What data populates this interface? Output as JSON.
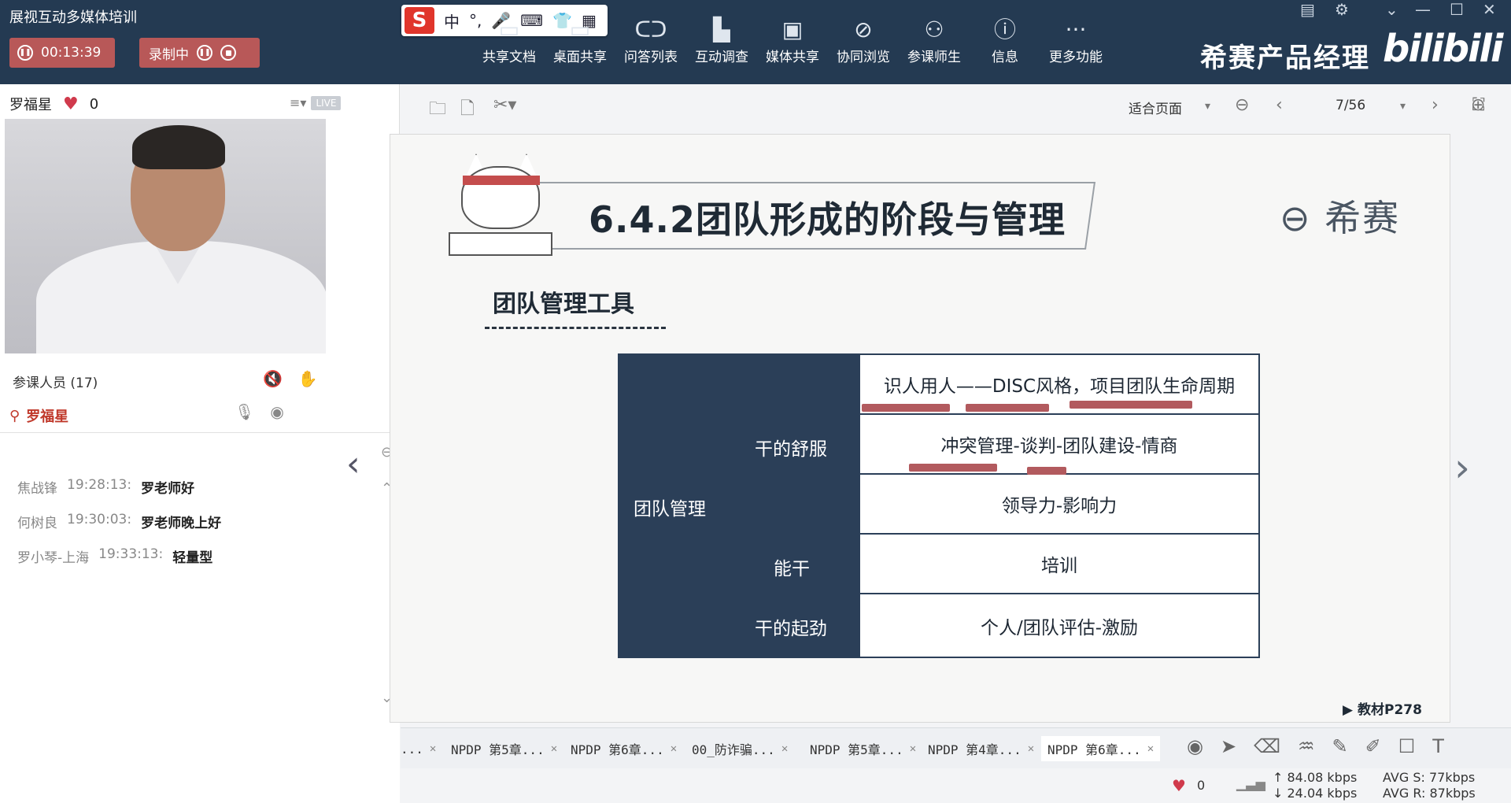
{
  "window": {
    "title": "展视互动多媒体培训"
  },
  "recording": {
    "timer": "00:13:39",
    "status_label": "录制中"
  },
  "ime": {
    "lang": "中",
    "punct": "°,"
  },
  "toolbar": [
    {
      "label": "共享文档",
      "icon": "document-icon"
    },
    {
      "label": "桌面共享",
      "icon": "desktop-icon"
    },
    {
      "label": "问答列表",
      "icon": "qa-icon"
    },
    {
      "label": "互动调查",
      "icon": "chart-icon"
    },
    {
      "label": "媒体共享",
      "icon": "media-icon"
    },
    {
      "label": "协同浏览",
      "icon": "compass-icon"
    },
    {
      "label": "参课师生",
      "icon": "users-icon"
    },
    {
      "label": "信息",
      "icon": "info-icon"
    },
    {
      "label": "更多功能",
      "icon": "more-icon"
    }
  ],
  "brand": {
    "name": "希赛产品经理",
    "site": "bilibili"
  },
  "presenter": {
    "name": "罗福星",
    "likes": "0",
    "live": "LIVE"
  },
  "attendees": {
    "label": "参课人员 (17)",
    "self_name": "罗福星"
  },
  "chat": [
    {
      "user": "焦战锋",
      "time": "19:28:13:",
      "text": "罗老师好"
    },
    {
      "user": "何树良",
      "time": "19:30:03:",
      "text": "罗老师晚上好"
    },
    {
      "user": "罗小琴-上海",
      "time": "19:33:13:",
      "text": "轻量型"
    }
  ],
  "doc_toolbar": {
    "zoom": "适合页面",
    "page": "7/56"
  },
  "slide": {
    "title": "6.4.2团队形成的阶段与管理",
    "logo": "希赛",
    "section": "团队管理工具",
    "table": {
      "group_label": "团队管理",
      "sub_labels": [
        "干的舒服",
        "能干",
        "干的起劲"
      ],
      "rows": [
        "识人用人——DISC风格，项目团队生命周期",
        "冲突管理-谈判-团队建设-情商",
        "领导力-影响力",
        "培训",
        "个人/团队评估-激励"
      ]
    },
    "book_ref": "教材P278"
  },
  "tabs": [
    {
      "label": "..."
    },
    {
      "label": "NPDP 第5章..."
    },
    {
      "label": "NPDP 第6章..."
    },
    {
      "label": "00_防诈骗..."
    },
    {
      "label": "NPDP 第5章..."
    },
    {
      "label": "NPDP 第4章..."
    },
    {
      "label": "NPDP 第6章..."
    }
  ],
  "status": {
    "likes": "0",
    "up": "84.08 kbps",
    "down": "24.04 kbps",
    "avg_s": "AVG S: 77kbps",
    "avg_r": "AVG R: 87kbps"
  }
}
